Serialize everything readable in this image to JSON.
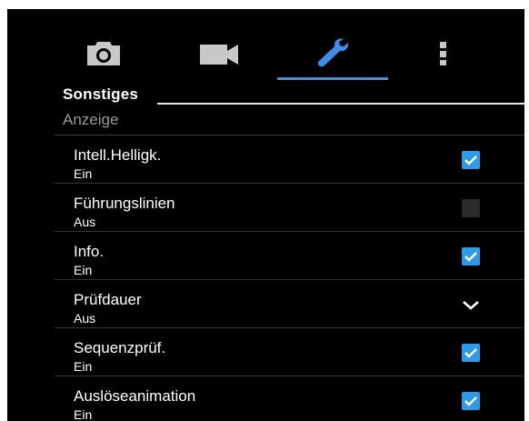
{
  "tabs": [
    {
      "icon": "camera-icon",
      "label": ""
    },
    {
      "icon": "video-icon",
      "label": ""
    },
    {
      "icon": "wrench-icon",
      "label": ""
    },
    {
      "icon": "more-vertical-icon",
      "label": ""
    }
  ],
  "active_tab": 2,
  "colors": {
    "background": "#000000",
    "accent": "#4a8fd6",
    "checkbox_checked": "#2f9ae8",
    "checkbox_unchecked": "#2b2b2b",
    "category_text": "#9a9a9a"
  },
  "section": {
    "title": "Sonstiges"
  },
  "category": {
    "label": "Anzeige"
  },
  "settings": [
    {
      "title": "Intell.Helligk.",
      "value": "Ein",
      "control": "checkbox",
      "checked": true
    },
    {
      "title": "Führungslinien",
      "value": "Aus",
      "control": "checkbox",
      "checked": false
    },
    {
      "title": "Info.",
      "value": "Ein",
      "control": "checkbox",
      "checked": true
    },
    {
      "title": "Prüfdauer",
      "value": "Aus",
      "control": "dropdown",
      "icon": "chevron-down-icon"
    },
    {
      "title": "Sequenzprüf.",
      "value": "Ein",
      "control": "checkbox",
      "checked": true
    },
    {
      "title": "Auslöseanimation",
      "value": "Ein",
      "control": "checkbox",
      "checked": true
    }
  ]
}
